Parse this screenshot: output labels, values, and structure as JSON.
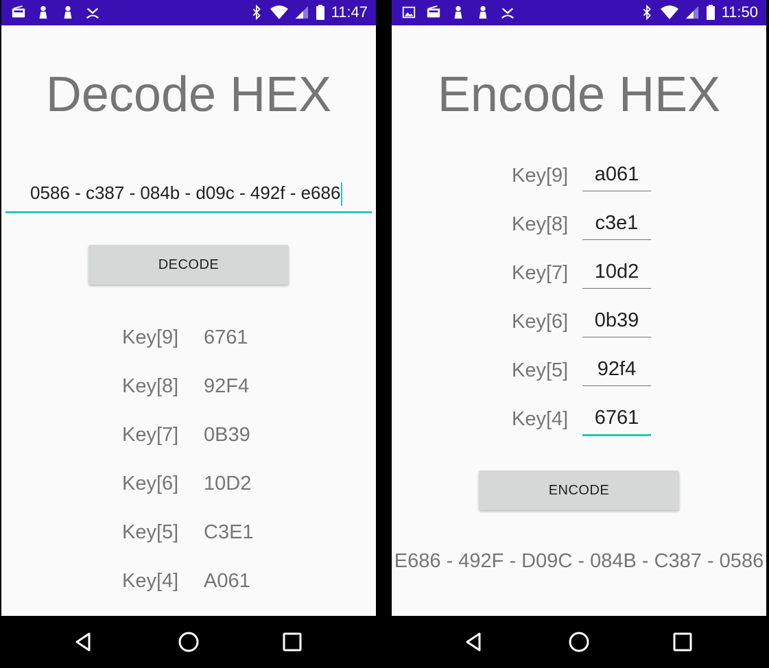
{
  "left": {
    "status": {
      "time": "11:47",
      "left_icons": [
        "radio-icon",
        "person-icon",
        "person-icon",
        "missed-call-icon"
      ],
      "right_icons": [
        "bluetooth-icon",
        "wifi-icon",
        "signal-icon",
        "battery-icon"
      ]
    },
    "title": "Decode HEX",
    "input_value": "0586 - c387 - 084b - d09c - 492f - e686",
    "button_label": "DECODE",
    "keys": [
      {
        "label": "Key[9]",
        "value": "6761"
      },
      {
        "label": "Key[8]",
        "value": "92F4"
      },
      {
        "label": "Key[7]",
        "value": "0B39"
      },
      {
        "label": "Key[6]",
        "value": "10D2"
      },
      {
        "label": "Key[5]",
        "value": "C3E1"
      },
      {
        "label": "Key[4]",
        "value": "A061"
      }
    ]
  },
  "right": {
    "status": {
      "time": "11:50",
      "left_icons": [
        "image-icon",
        "radio-icon",
        "person-icon",
        "person-icon",
        "missed-call-icon"
      ],
      "right_icons": [
        "bluetooth-icon",
        "wifi-icon",
        "signal-icon",
        "battery-icon"
      ]
    },
    "title": "Encode HEX",
    "keys": [
      {
        "label": "Key[9]",
        "value": "a061"
      },
      {
        "label": "Key[8]",
        "value": "c3e1"
      },
      {
        "label": "Key[7]",
        "value": "10d2"
      },
      {
        "label": "Key[6]",
        "value": "0b39"
      },
      {
        "label": "Key[5]",
        "value": "92f4"
      },
      {
        "label": "Key[4]",
        "value": "6761"
      }
    ],
    "button_label": "ENCODE",
    "result": "E686 - 492F - D09C - 084B - C387 - 0586"
  },
  "colors": {
    "status_bar": "#3a10b5",
    "accent": "#26c6b8",
    "text_gray": "#757575",
    "button_bg": "#d6d7d7"
  }
}
